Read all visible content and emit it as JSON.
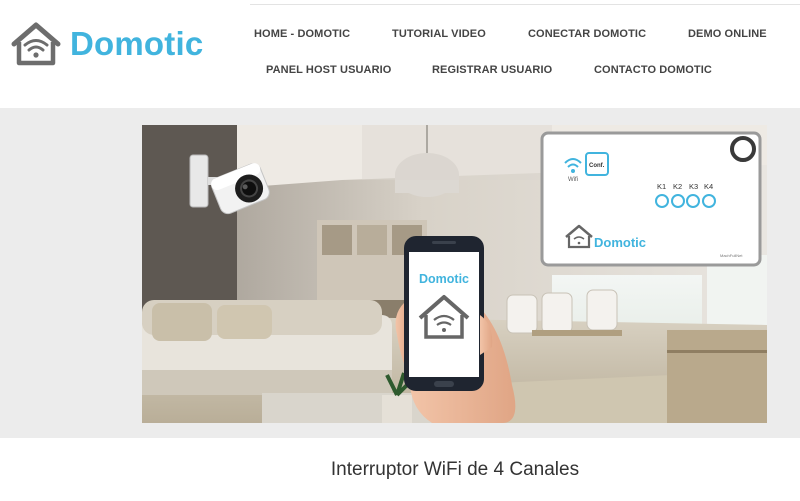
{
  "brand": {
    "name": "Domotic",
    "accent": "#41b4de",
    "icon": "house-wifi-icon"
  },
  "nav": {
    "row1": [
      "HOME - DOMOTIC",
      "TUTORIAL VIDEO",
      "CONECTAR DOMOTIC",
      "DEMO ONLINE"
    ],
    "row2": [
      "PANEL HOST USUARIO",
      "REGISTRAR USUARIO",
      "CONTACTO DOMOTIC"
    ]
  },
  "hero": {
    "phone_brand": "Domotic",
    "device": {
      "wifi_label": "Wifi",
      "conf_label": "Conf.",
      "channels": [
        "K1",
        "K2",
        "K3",
        "K4"
      ],
      "brand": "Domotic",
      "small_print": "MachFullNet"
    }
  },
  "page_title": "Interruptor WiFi de 4 Canales"
}
